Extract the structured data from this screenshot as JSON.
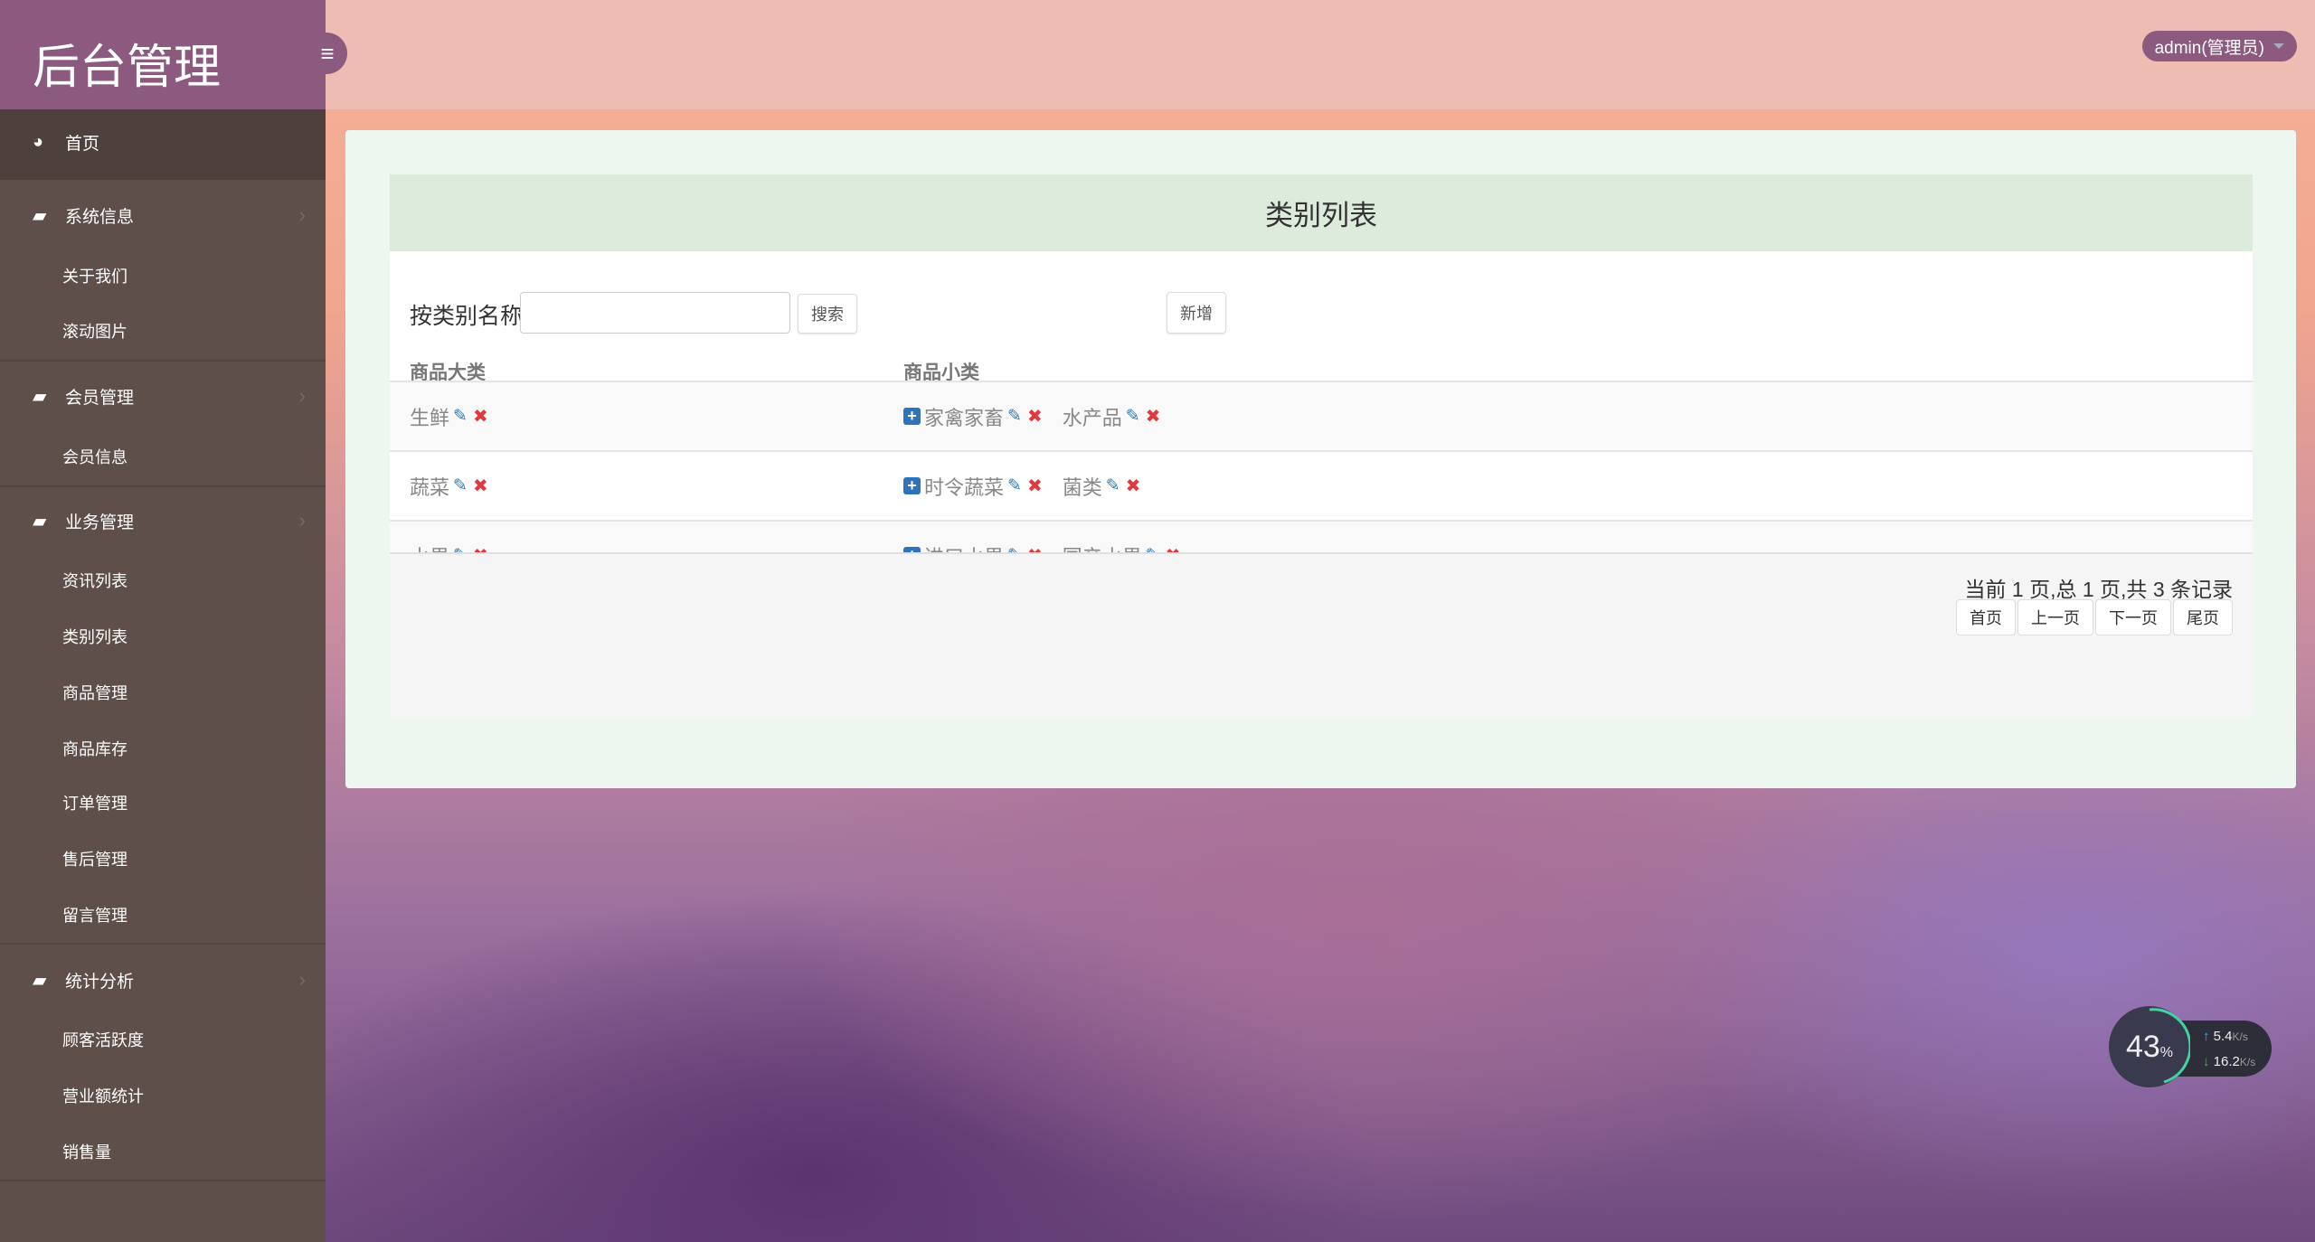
{
  "app": {
    "title": "后台管理",
    "admin_label": "admin(管理员)"
  },
  "sidebar": {
    "home": "首页",
    "groups": [
      {
        "label": "系统信息",
        "items": [
          "关于我们",
          "滚动图片"
        ]
      },
      {
        "label": "会员管理",
        "items": [
          "会员信息"
        ]
      },
      {
        "label": "业务管理",
        "items": [
          "资讯列表",
          "类别列表",
          "商品管理",
          "商品库存",
          "订单管理",
          "售后管理",
          "留言管理"
        ]
      },
      {
        "label": "统计分析",
        "items": [
          "顾客活跃度",
          "营业额统计",
          "销售量"
        ]
      }
    ]
  },
  "main": {
    "title": "类别列表",
    "search_label": "按类别名称",
    "search_value": "",
    "search_button": "搜索",
    "add_button": "新增",
    "columns": [
      "商品大类",
      "商品小类"
    ],
    "rows": [
      {
        "category": "生鲜",
        "subs": [
          "家禽家畜",
          "水产品"
        ]
      },
      {
        "category": "蔬菜",
        "subs": [
          "时令蔬菜",
          "菌类"
        ]
      },
      {
        "category": "水果",
        "subs": [
          "进口水果",
          "国产水果"
        ]
      }
    ],
    "pagination": {
      "info": "当前 1 页,总 1 页,共 3 条记录",
      "first": "首页",
      "prev": "上一页",
      "next": "下一页",
      "last": "尾页"
    }
  },
  "widget": {
    "percent": "43",
    "percent_unit": "%",
    "up": "5.4",
    "down": "16.2",
    "unit": "K/s"
  }
}
